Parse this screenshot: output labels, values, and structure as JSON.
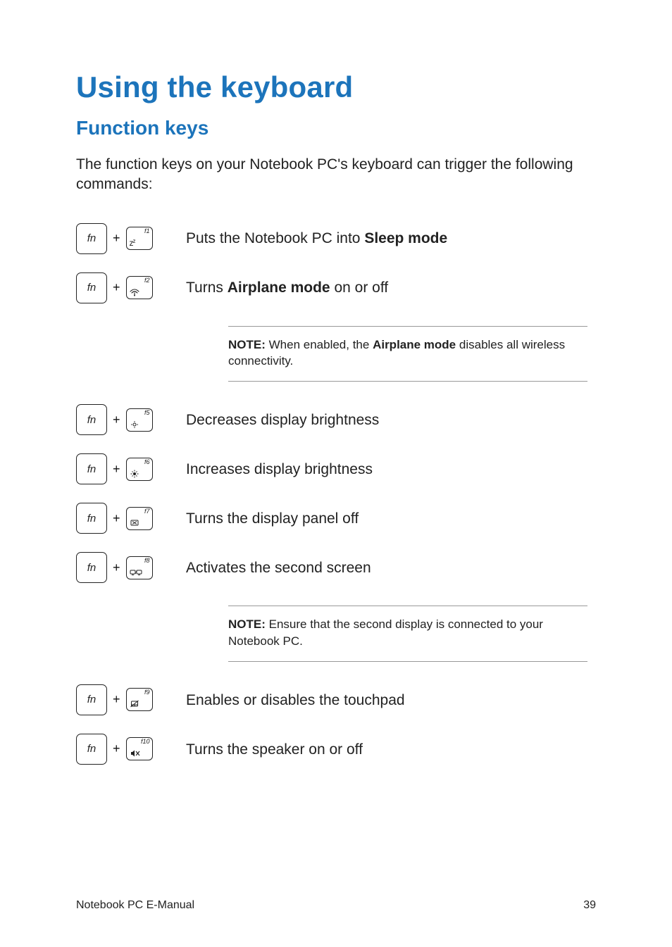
{
  "title": "Using the keyboard",
  "subtitle": "Function keys",
  "intro": "The function keys on your Notebook PC's keyboard can trigger the following commands:",
  "fn_label": "fn",
  "plus": "+",
  "rows": {
    "r0": {
      "fkey": "f1",
      "desc_pre": "Puts the Notebook PC into ",
      "desc_bold": "Sleep mode",
      "desc_post": ""
    },
    "r1": {
      "fkey": "f2",
      "desc_pre": "Turns ",
      "desc_bold": "Airplane mode",
      "desc_post": " on or off"
    },
    "r2": {
      "fkey": "f5",
      "desc": "Decreases display brightness"
    },
    "r3": {
      "fkey": "f6",
      "desc": "Increases display brightness"
    },
    "r4": {
      "fkey": "f7",
      "desc": "Turns the display panel off"
    },
    "r5": {
      "fkey": "f8",
      "desc": "Activates the second screen"
    },
    "r6": {
      "fkey": "f9",
      "desc": "Enables or disables the touchpad"
    },
    "r7": {
      "fkey": "f10",
      "desc": "Turns the speaker on or off"
    }
  },
  "notes": {
    "n0": {
      "label": "NOTE:",
      "pre": " When enabled, the ",
      "bold": "Airplane mode",
      "post": " disables all wireless connectivity."
    },
    "n1": {
      "label": "NOTE:",
      "text": " Ensure that the second display is connected to your Notebook PC."
    }
  },
  "footer": {
    "left": "Notebook PC E-Manual",
    "right": "39"
  }
}
